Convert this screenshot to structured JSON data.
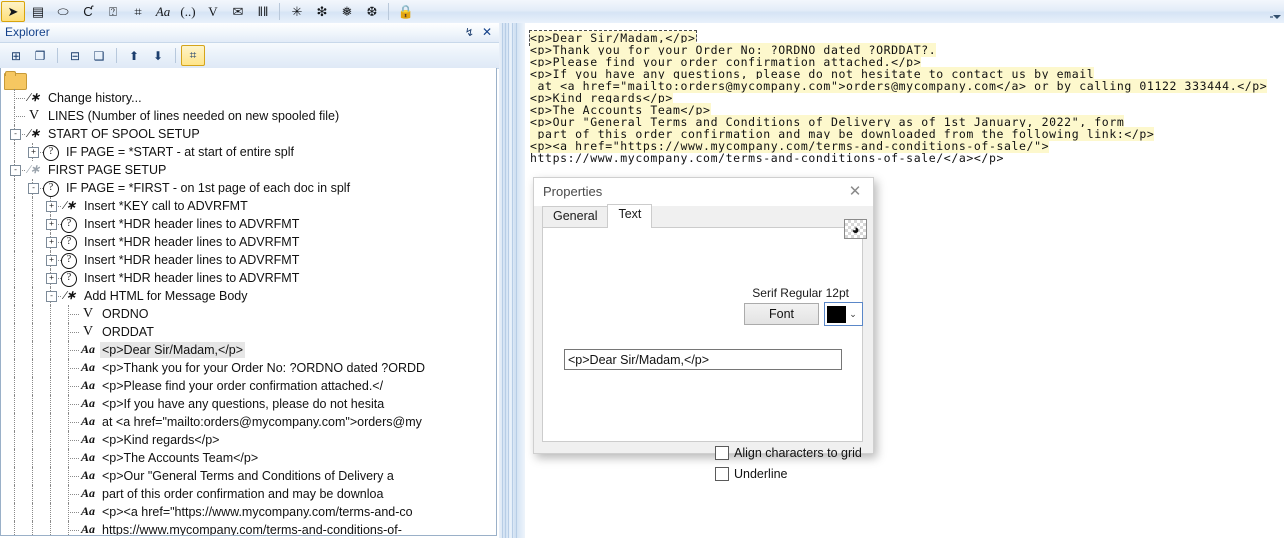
{
  "toolbar": {
    "items": [
      {
        "name": "pointer-icon",
        "glyph": "➤",
        "selected": true
      },
      {
        "name": "form-icon",
        "glyph": "▤",
        "selected": false
      },
      {
        "name": "eraser-icon",
        "glyph": "⬭",
        "selected": false
      },
      {
        "name": "hook-icon",
        "glyph": "Ƈ",
        "selected": false
      },
      {
        "name": "question-icon",
        "glyph": "⍰",
        "selected": false
      },
      {
        "name": "image-icon",
        "glyph": "⌗",
        "selected": false
      },
      {
        "name": "text-aa-icon",
        "glyph": "Aa",
        "selected": false
      },
      {
        "name": "parens-icon",
        "glyph": "(..)",
        "selected": false
      },
      {
        "name": "variable-icon",
        "glyph": "V",
        "selected": false
      },
      {
        "name": "mail-icon",
        "glyph": "✉",
        "selected": false
      },
      {
        "name": "barcode-icon",
        "glyph": "‖‖",
        "selected": false
      }
    ],
    "items2": [
      {
        "name": "snowflake-one-icon",
        "glyph": "✳"
      },
      {
        "name": "snowflake-two-icon",
        "glyph": "❇"
      },
      {
        "name": "snowflake-three-icon",
        "glyph": "❅"
      },
      {
        "name": "snowflake-four-icon",
        "glyph": "❆"
      }
    ],
    "items3": [
      {
        "name": "lock-icon",
        "glyph": "🔒"
      }
    ]
  },
  "explorer": {
    "title": "Explorer",
    "pin_glyph": "↯",
    "close_glyph": "✕",
    "toolbar": [
      {
        "name": "expand-node-button",
        "glyph": "⊞",
        "selected": false
      },
      {
        "name": "expand-all-button",
        "glyph": "❐",
        "selected": false
      },
      {
        "name": "collapse-node-button",
        "glyph": "⊟",
        "selected": false
      },
      {
        "name": "collapse-all-button",
        "glyph": "❑",
        "selected": false
      },
      {
        "name": "move-up-button",
        "glyph": "⬆",
        "selected": false
      },
      {
        "name": "move-down-button",
        "glyph": "⬇",
        "selected": false
      },
      {
        "name": "properties-button",
        "glyph": "⌗",
        "selected": true
      }
    ],
    "tree": [
      {
        "depth": 0,
        "icon": "folder",
        "label": "",
        "expander": "",
        "selected": false
      },
      {
        "depth": 1,
        "icon": "comment",
        "label": "Change history...",
        "expander": "",
        "selected": false
      },
      {
        "depth": 1,
        "icon": "var",
        "label": "LINES  (Number of lines needed on new spooled file)",
        "expander": "",
        "selected": false
      },
      {
        "depth": 1,
        "icon": "comment",
        "label": "START OF SPOOL SETUP",
        "expander": "-",
        "selected": false
      },
      {
        "depth": 2,
        "icon": "question",
        "label": "IF PAGE = *START - at start of entire splf",
        "expander": "+",
        "selected": false
      },
      {
        "depth": 1,
        "icon": "comment-dim",
        "label": "FIRST PAGE SETUP",
        "expander": "-",
        "selected": false
      },
      {
        "depth": 2,
        "icon": "question",
        "label": "IF PAGE = *FIRST - on 1st page of each doc in splf",
        "expander": "-",
        "selected": false
      },
      {
        "depth": 3,
        "icon": "comment",
        "label": "Insert *KEY call to ADVRFMT",
        "expander": "+",
        "selected": false
      },
      {
        "depth": 3,
        "icon": "question",
        "label": "Insert *HDR header lines to ADVRFMT",
        "expander": "+",
        "selected": false
      },
      {
        "depth": 3,
        "icon": "question",
        "label": "Insert *HDR header lines to ADVRFMT",
        "expander": "+",
        "selected": false
      },
      {
        "depth": 3,
        "icon": "question",
        "label": "Insert *HDR header lines to ADVRFMT",
        "expander": "+",
        "selected": false
      },
      {
        "depth": 3,
        "icon": "question",
        "label": "Insert *HDR header lines to ADVRFMT",
        "expander": "+",
        "selected": false
      },
      {
        "depth": 3,
        "icon": "comment",
        "label": "Add HTML for Message Body",
        "expander": "-",
        "selected": false
      },
      {
        "depth": 4,
        "icon": "var",
        "label": "ORDNO",
        "expander": "",
        "selected": false
      },
      {
        "depth": 4,
        "icon": "var",
        "label": "ORDDAT",
        "expander": "",
        "selected": false
      },
      {
        "depth": 4,
        "icon": "aa",
        "label": "<p>Dear Sir/Madam,</p>",
        "expander": "",
        "selected": true
      },
      {
        "depth": 4,
        "icon": "aa",
        "label": "<p>Thank you for your Order No: ?ORDNO dated ?ORDD",
        "expander": "",
        "selected": false
      },
      {
        "depth": 4,
        "icon": "aa",
        "label": "<p>Please find your order confirmation attached.</",
        "expander": "",
        "selected": false
      },
      {
        "depth": 4,
        "icon": "aa",
        "label": "<p>If you have any questions, please do not hesita",
        "expander": "",
        "selected": false
      },
      {
        "depth": 4,
        "icon": "aa",
        "label": "at <a href=\"mailto:orders@mycompany.com\">orders@my",
        "expander": "",
        "selected": false
      },
      {
        "depth": 4,
        "icon": "aa",
        "label": "<p>Kind regards</p>",
        "expander": "",
        "selected": false
      },
      {
        "depth": 4,
        "icon": "aa",
        "label": "<p>The Accounts Team</p>",
        "expander": "",
        "selected": false
      },
      {
        "depth": 4,
        "icon": "aa",
        "label": "<p>Our \"General Terms and Conditions of Delivery a",
        "expander": "",
        "selected": false
      },
      {
        "depth": 4,
        "icon": "aa",
        "label": "part of this order confirmation and may be downloa",
        "expander": "",
        "selected": false
      },
      {
        "depth": 4,
        "icon": "aa",
        "label": "<p><a href=\"https://www.mycompany.com/terms-and-co",
        "expander": "",
        "selected": false
      },
      {
        "depth": 4,
        "icon": "aa",
        "label": "https://www.mycompany.com/terms-and-conditions-of-",
        "expander": "",
        "selected": false
      }
    ]
  },
  "editor": {
    "lines": [
      {
        "text": "<p>Dear Sir/Madam,</p>",
        "highlight": true,
        "current": true
      },
      {
        "text": "<p>Thank you for your Order No: ?ORDNO dated ?ORDDAT?.",
        "highlight": true,
        "current": false
      },
      {
        "text": "<p>Please find your order confirmation attached.</p>",
        "highlight": true,
        "current": false
      },
      {
        "text": "<p>If you have any questions, please do not hesitate to contact us by email",
        "highlight": true,
        "current": false
      },
      {
        "text": " at <a href=\"mailto:orders@mycompany.com\">orders@mycompany.com</a> or by calling 01122 333444.</p>",
        "highlight": true,
        "current": false
      },
      {
        "text": "<p>Kind regards</p>",
        "highlight": true,
        "current": false
      },
      {
        "text": "<p>The Accounts Team</p>",
        "highlight": true,
        "current": false
      },
      {
        "text": "<p>Our \"General Terms and Conditions of Delivery as of 1st January, 2022\", form",
        "highlight": true,
        "current": false
      },
      {
        "text": " part of this order confirmation and may be downloaded from the following link:</p>",
        "highlight": true,
        "current": false
      },
      {
        "text": "<p><a href=\"https://www.mycompany.com/terms-and-conditions-of-sale/\">",
        "highlight": true,
        "current": false
      },
      {
        "text": "https://www.mycompany.com/terms-and-conditions-of-sale/</a></p>",
        "highlight": false,
        "current": false
      }
    ]
  },
  "dialog": {
    "title": "Properties",
    "close_glyph": "✕",
    "tabs": [
      {
        "label": "General",
        "active": false
      },
      {
        "label": "Text",
        "active": true
      }
    ],
    "globe_glyph": "◕",
    "font_summary": "Serif Regular 12pt",
    "font_button": "Font",
    "color_value": "#000000",
    "color_arrow": "⌄",
    "text_value": "<p>Dear Sir/Madam,</p>",
    "checkboxes": [
      {
        "label": "Align characters to grid",
        "checked": false
      },
      {
        "label": "Underline",
        "checked": false
      }
    ]
  },
  "canvas": {
    "background_color": "#ffff00"
  }
}
